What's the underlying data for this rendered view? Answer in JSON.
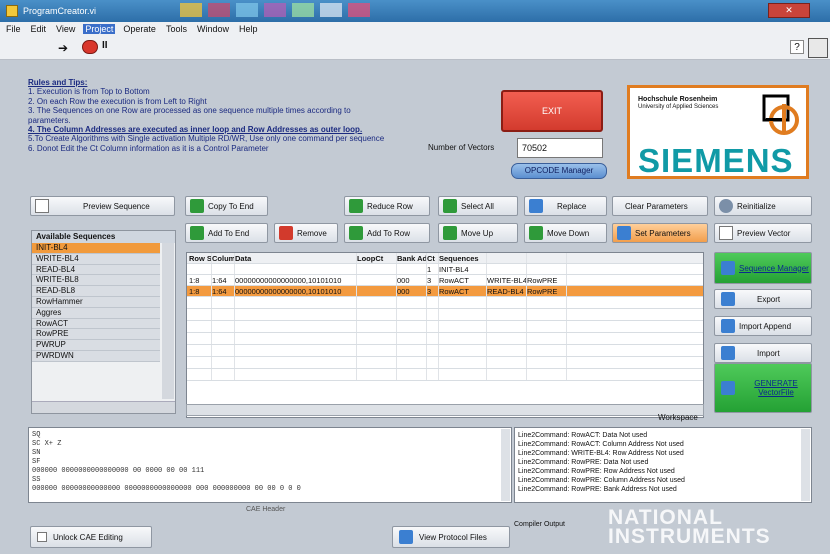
{
  "window": {
    "title": "ProgramCreator.vi",
    "close_label": "✕"
  },
  "menu": [
    "File",
    "Edit",
    "View",
    "Project",
    "Operate",
    "Tools",
    "Window",
    "Help"
  ],
  "toolbar": {
    "run": "➔",
    "pause": "II",
    "help": "?"
  },
  "rules": {
    "heading": "Rules and Tips:",
    "lines": [
      "1. Execution is from Top to Bottom",
      "2. On each Row the execution is from Left to Right",
      "3. The Sequences on one Row are processed as one sequence multiple times according to parameters."
    ],
    "line4": "4. The Column Addresses are executed as inner loop and Row Addresses as outer loop.",
    "line5": "5.To Create Algorithms with Single activation Multiple RD/WR, Use only one command per sequence",
    "line6": "6. Donot Edit the Ct Column information as it is a Control Parameter"
  },
  "exit_label": "EXIT",
  "vectors": {
    "label": "Number of Vectors",
    "value": "70502"
  },
  "opcode_label": "OPCODE Manager",
  "logo": {
    "school": "Hochschule Rosenheim",
    "school_sub": "University of Applied Sciences",
    "brand": "SIEMENS"
  },
  "buttons": {
    "preview_sequence": "Preview Sequence",
    "copy_to_end": "Copy To End",
    "reduce_row": "Reduce Row",
    "select_all": "Select All",
    "replace": "Replace",
    "clear_parameters": "Clear Parameters",
    "reinitialize": "Reinitialize",
    "add_to_end": "Add To End",
    "remove": "Remove",
    "add_to_row": "Add To Row",
    "move_up": "Move Up",
    "move_down": "Move Down",
    "set_parameters": "Set Parameters",
    "preview_vector": "Preview Vector",
    "sequence_manager": "Sequence Manager",
    "export": "Export",
    "import_append": "Import Append",
    "import": "Import",
    "generate": "GENERATE VectorFile",
    "unlock_cae": "Unlock CAE Editing",
    "view_protocol": "View Protocol Files"
  },
  "sequences": {
    "header": "Available Sequences",
    "items": [
      "INIT-BL4",
      "WRITE-BL4",
      "READ-BL4",
      "WRITE-BL8",
      "READ-BL8",
      "RowHammer",
      "Aggres",
      "RowACT",
      "RowPRE",
      "PWRUP",
      "PWRDWN"
    ]
  },
  "table": {
    "columns": [
      "Row Sel",
      "Column",
      "Data",
      "LoopCt",
      "Bank Adr",
      "Ct",
      "Sequences",
      "",
      "",
      ""
    ],
    "rows": [
      [
        "",
        "",
        "",
        "",
        "",
        "1",
        "INIT-BL4",
        "",
        "",
        ""
      ],
      [
        "1:8",
        "1:64",
        "00000000000000000,10101010",
        "",
        "000",
        "3",
        "RowACT",
        "WRITE-BL4",
        "RowPRE",
        ""
      ],
      [
        "1:8",
        "1:64",
        "00000000000000000,10101010",
        "",
        "000",
        "3",
        "RowACT",
        "READ-BL4",
        "RowPRE",
        ""
      ]
    ],
    "selected_row": 2
  },
  "workspace_label": "Workspace",
  "cae": {
    "label": "CAE Header",
    "lines": [
      "SQ",
      "SC X+ Z",
      "SN",
      "SF",
      "000000 0000000000000000 00 0000 00 00 111",
      "SS",
      "000000 00000000000000 0000000000000000 000 000000000 00 00 0 0 0"
    ]
  },
  "compiler": {
    "label": "Compiler Output",
    "lines": [
      "Line2Command: RowACT: Data Not used",
      "Line2Command: RowACT: Column Address Not used",
      "Line2Command: WRITE-BL4: Row Address Not used",
      "Line2Command: RowPRE: Data Not used",
      "Line2Command: RowPRE: Row Address Not used",
      "Line2Command: RowPRE: Column Address Not used",
      "Line2Command: RowPRE: Bank Address Not used"
    ]
  },
  "watermark": {
    "line1": "NATIONAL",
    "line2": "INSTRUMENTS"
  }
}
